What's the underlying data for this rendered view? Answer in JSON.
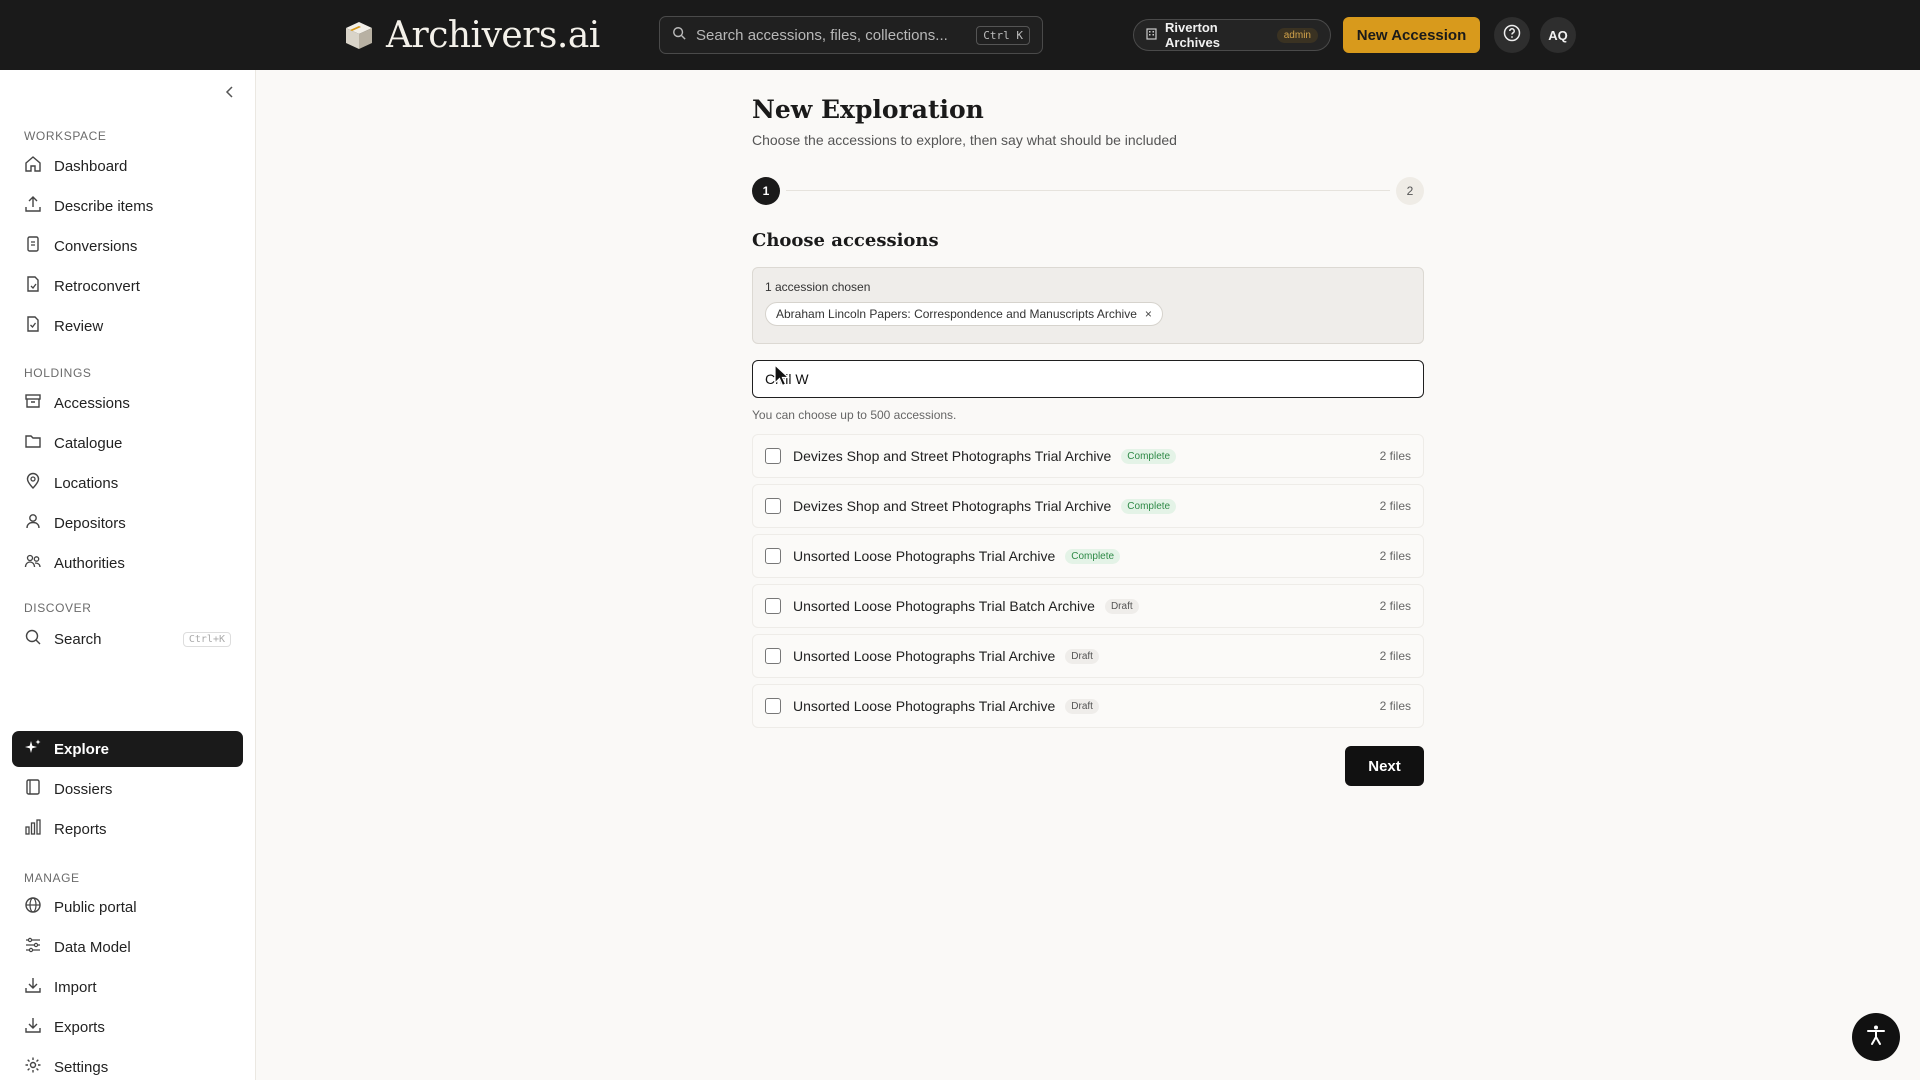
{
  "app": {
    "name": "Archivers.ai",
    "search_placeholder": "Search accessions, files, collections...",
    "search_kbd": "Ctrl K",
    "org_name": "Riverton Archives",
    "org_role": "admin",
    "new_accession_label": "New Accession",
    "avatar_initials": "AQ",
    "accent_color": "#d89a1c"
  },
  "sidebar": {
    "sections": [
      {
        "title": "WORKSPACE",
        "items": [
          {
            "label": "Dashboard",
            "icon": "home-icon"
          },
          {
            "label": "Describe items",
            "icon": "upload-icon"
          },
          {
            "label": "Conversions",
            "icon": "conversions-icon"
          },
          {
            "label": "Retroconvert",
            "icon": "retroconvert-icon"
          },
          {
            "label": "Review",
            "icon": "review-icon"
          }
        ]
      },
      {
        "title": "HOLDINGS",
        "items": [
          {
            "label": "Accessions",
            "icon": "archive-box-icon"
          },
          {
            "label": "Catalogue",
            "icon": "folder-icon"
          },
          {
            "label": "Locations",
            "icon": "map-pin-icon"
          },
          {
            "label": "Depositors",
            "icon": "user-icon"
          },
          {
            "label": "Authorities",
            "icon": "authorities-icon"
          }
        ]
      },
      {
        "title": "DISCOVER",
        "items": [
          {
            "label": "Search",
            "icon": "search-icon",
            "kbd": "Ctrl+K"
          },
          {
            "label": "Explore",
            "icon": "sparkles-icon",
            "active": true
          },
          {
            "label": "Dossiers",
            "icon": "book-icon"
          },
          {
            "label": "Reports",
            "icon": "bar-chart-icon"
          }
        ]
      },
      {
        "title": "MANAGE",
        "items": [
          {
            "label": "Public portal",
            "icon": "globe-icon"
          },
          {
            "label": "Data Model",
            "icon": "sliders-icon"
          },
          {
            "label": "Import",
            "icon": "import-icon"
          },
          {
            "label": "Exports",
            "icon": "export-icon"
          },
          {
            "label": "Settings",
            "icon": "gear-icon"
          }
        ]
      }
    ]
  },
  "main": {
    "title": "New Exploration",
    "subtitle": "Choose the accessions to explore, then say what should be included",
    "step_current": "1",
    "step_next": "2",
    "section_title": "Choose accessions",
    "chosen_count": "1 accession chosen",
    "chosen_chip": "Abraham Lincoln Papers: Correspondence and Manuscripts Archive",
    "filter_value": "Civil W",
    "hint": "You can choose up to 500 accessions.",
    "results": [
      {
        "title": "Devizes Shop and Street Photographs Trial Archive",
        "status": "Complete",
        "files": "2 files"
      },
      {
        "title": "Devizes Shop and Street Photographs Trial Archive",
        "status": "Complete",
        "files": "2 files"
      },
      {
        "title": "Unsorted Loose Photographs Trial Archive",
        "status": "Complete",
        "files": "2 files"
      },
      {
        "title": "Unsorted Loose Photographs Trial Batch Archive",
        "status": "Draft",
        "files": "2 files"
      },
      {
        "title": "Unsorted Loose Photographs Trial Archive",
        "status": "Draft",
        "files": "2 files"
      },
      {
        "title": "Unsorted Loose Photographs Trial Archive",
        "status": "Draft",
        "files": "2 files"
      }
    ],
    "next_label": "Next"
  }
}
